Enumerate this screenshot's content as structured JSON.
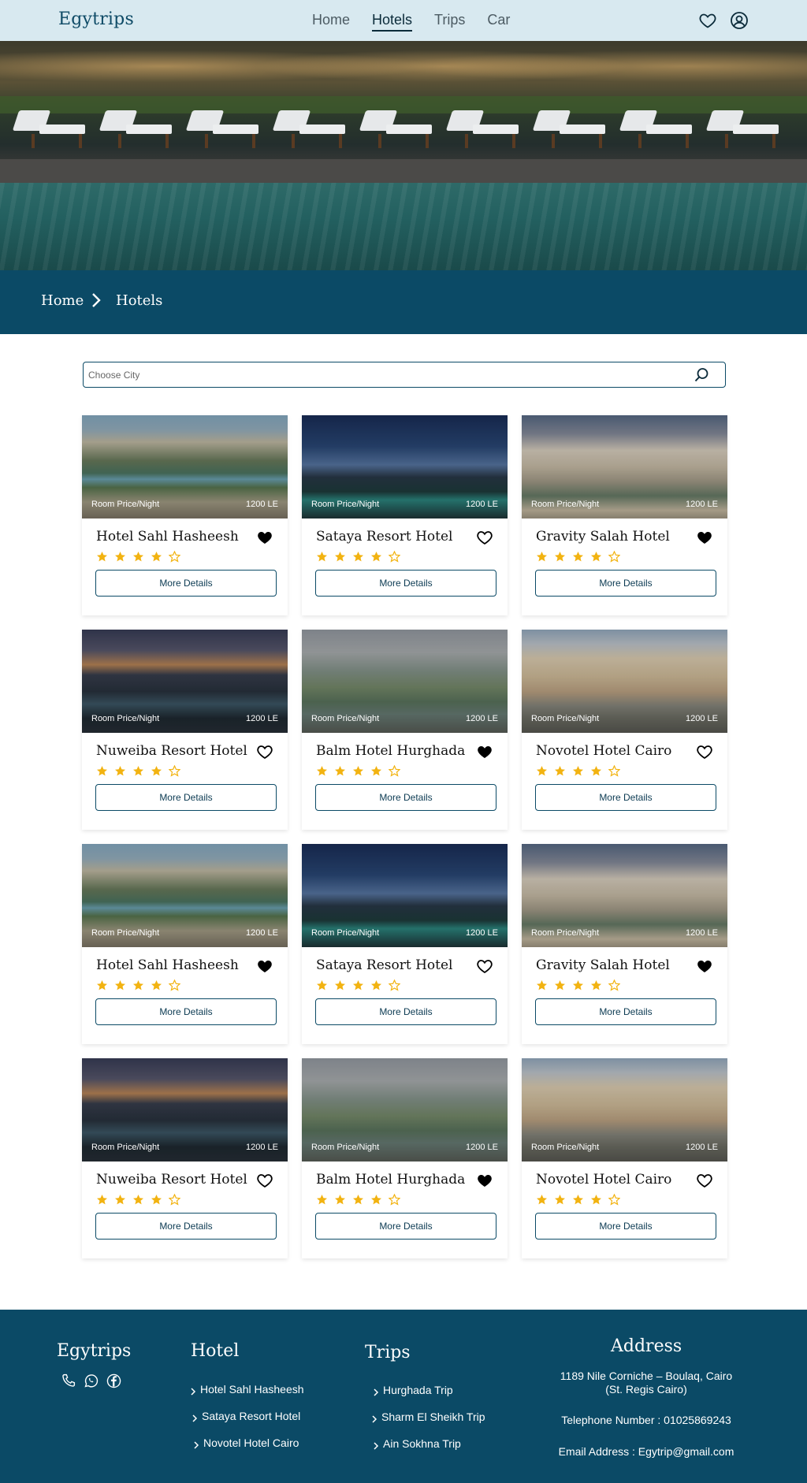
{
  "nav": {
    "brand": "Egytrips",
    "links": [
      "Home",
      "Hotels",
      "Trips",
      "Car"
    ],
    "active": "Hotels"
  },
  "breadcrumb": {
    "home": "Home",
    "current": "Hotels"
  },
  "search": {
    "placeholder": "Choose City",
    "value": ""
  },
  "card_labels": {
    "price_label": "Room Price/Night",
    "details_button": "More Details"
  },
  "hotels": [
    {
      "name": "Hotel Sahl Hasheesh",
      "price": "1200 LE",
      "rating": 4,
      "favorite": true
    },
    {
      "name": "Sataya Resort Hotel",
      "price": "1200 LE",
      "rating": 4,
      "favorite": false
    },
    {
      "name": "Gravity Salah Hotel",
      "price": "1200 LE",
      "rating": 4,
      "favorite": true
    },
    {
      "name": "Nuweiba Resort Hotel",
      "price": "1200 LE",
      "rating": 4,
      "favorite": false
    },
    {
      "name": "Balm Hotel Hurghada",
      "price": "1200 LE",
      "rating": 4,
      "favorite": true
    },
    {
      "name": "Novotel Hotel Cairo",
      "price": "1200 LE",
      "rating": 4,
      "favorite": false
    },
    {
      "name": "Hotel Sahl Hasheesh",
      "price": "1200 LE",
      "rating": 4,
      "favorite": true
    },
    {
      "name": "Sataya Resort Hotel",
      "price": "1200 LE",
      "rating": 4,
      "favorite": false
    },
    {
      "name": "Gravity Salah Hotel",
      "price": "1200 LE",
      "rating": 4,
      "favorite": true
    },
    {
      "name": "Nuweiba Resort Hotel",
      "price": "1200 LE",
      "rating": 4,
      "favorite": false
    },
    {
      "name": "Balm Hotel Hurghada",
      "price": "1200 LE",
      "rating": 4,
      "favorite": true
    },
    {
      "name": "Novotel Hotel Cairo",
      "price": "1200 LE",
      "rating": 4,
      "favorite": false
    }
  ],
  "footer": {
    "brand": "Egytrips",
    "socials": [
      "phone-icon",
      "whatsapp-icon",
      "facebook-icon"
    ],
    "hotel_heading": "Hotel",
    "hotel_links": [
      "Hotel Sahl Hasheesh",
      "Sataya Resort Hotel",
      "Novotel Hotel Cairo"
    ],
    "trips_heading": "Trips",
    "trip_links": [
      "Hurghada Trip",
      "Sharm El Sheikh Trip",
      "Ain Sokhna Trip"
    ],
    "address_heading": "Address",
    "address_line1": "1189 Nile Corniche – Boulaq, Cairo",
    "address_line2": "(St. Regis Cairo)",
    "phone": "Telephone Number : 01025869243",
    "email": "Email Address : Egytrip@gmail.com"
  },
  "colors": {
    "primary": "#0b4a66",
    "nav_bg": "#d8e9f0",
    "star": "#f2b311"
  }
}
